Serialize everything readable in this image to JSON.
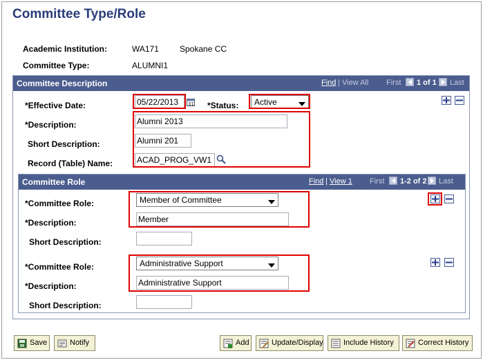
{
  "page": {
    "title": "Committee Type/Role"
  },
  "header": {
    "institution_label": "Academic Institution:",
    "institution_code": "WA171",
    "institution_name": "Spokane CC",
    "committee_type_label": "Committee Type:",
    "committee_type_value": "ALUMNI1"
  },
  "description_section": {
    "title": "Committee Description",
    "nav": {
      "find": "Find",
      "sep": "|",
      "view_all": "View All",
      "first": "First",
      "count": "1 of 1",
      "last": "Last"
    },
    "effective_date_label": "*Effective Date:",
    "effective_date_value": "05/22/2013",
    "status_label": "*Status:",
    "status_value": "Active",
    "description_label": "*Description:",
    "description_value": "Alumni 2013",
    "short_description_label": "Short Description:",
    "short_description_value": "Alumni 201",
    "record_label": "Record (Table) Name:",
    "record_value": "ACAD_PROG_VW1"
  },
  "role_section": {
    "title": "Committee Role",
    "nav": {
      "find": "Find",
      "sep": "|",
      "view": "View 1",
      "first": "First",
      "count": "1-2 of 2",
      "last": "Last"
    },
    "rows": [
      {
        "role_label": "*Committee Role:",
        "role_value": "Member of Committee",
        "description_label": "*Description:",
        "description_value": "Member",
        "short_description_label": "Short Description:",
        "short_description_value": ""
      },
      {
        "role_label": "*Committee Role:",
        "role_value": "Administrative Support",
        "description_label": "*Description:",
        "description_value": "Administrative Support",
        "short_description_label": "Short Description:",
        "short_description_value": ""
      }
    ]
  },
  "toolbar": {
    "save": "Save",
    "notify": "Notify",
    "add": "Add",
    "update_display": "Update/Display",
    "include_history": "Include History",
    "correct_history": "Correct History"
  },
  "colors": {
    "section_header": "#4b5d8e",
    "title": "#2a3d7a",
    "highlight": "#e00000",
    "button_bg": "#f3f1d6"
  },
  "icons": [
    "calendar-icon",
    "lookup-icon",
    "add-row-icon",
    "delete-row-icon",
    "save-icon",
    "notify-icon",
    "add-icon",
    "update-display-icon",
    "include-history-icon",
    "correct-history-icon"
  ]
}
